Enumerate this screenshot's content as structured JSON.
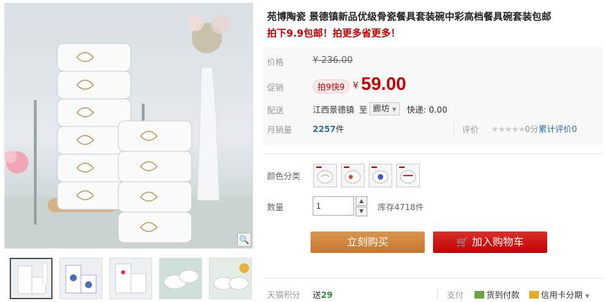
{
  "product": {
    "title": "苑博陶瓷 景德镇新品优级骨瓷餐具套装碗中彩高档餐具碗套装包邮",
    "subtitle": "拍下9.9包邮！拍更多省更多！"
  },
  "price": {
    "label": "价格",
    "currency": "¥",
    "original": "236.00"
  },
  "promotion": {
    "label": "促销",
    "badge": "拍9快9",
    "currency": "¥",
    "price": "59.00"
  },
  "shipping": {
    "label": "配送",
    "origin": "江西景德镇",
    "to": "至",
    "destination": "廊坊",
    "fee": "快递: 0.00"
  },
  "sales": {
    "label": "月销量",
    "count": "2257",
    "unit": "件"
  },
  "rating": {
    "label": "评价",
    "stars": "★★★★★",
    "score": "0分",
    "count_label": "累计评价",
    "count": "0"
  },
  "options": {
    "color_label": "颜色分类",
    "swatch_icons": [
      "bowl-gold-rose",
      "bowl-red-floral",
      "bowl-blue-floral",
      "bowl-red-pattern"
    ]
  },
  "quantity": {
    "label": "数量",
    "value": "1",
    "stock": "库存4718件"
  },
  "actions": {
    "buy_now": "立刻购买",
    "add_to_cart": "加入购物车"
  },
  "points": {
    "label": "天猫积分",
    "prefix": "送",
    "value": "29"
  },
  "payment": {
    "label": "支付",
    "cod": "货到付款",
    "credit": "信用卡分期"
  },
  "colors": {
    "accent_red": "#c40000",
    "buy_orange": "#c7772d",
    "link_blue": "#2f6fa8"
  }
}
